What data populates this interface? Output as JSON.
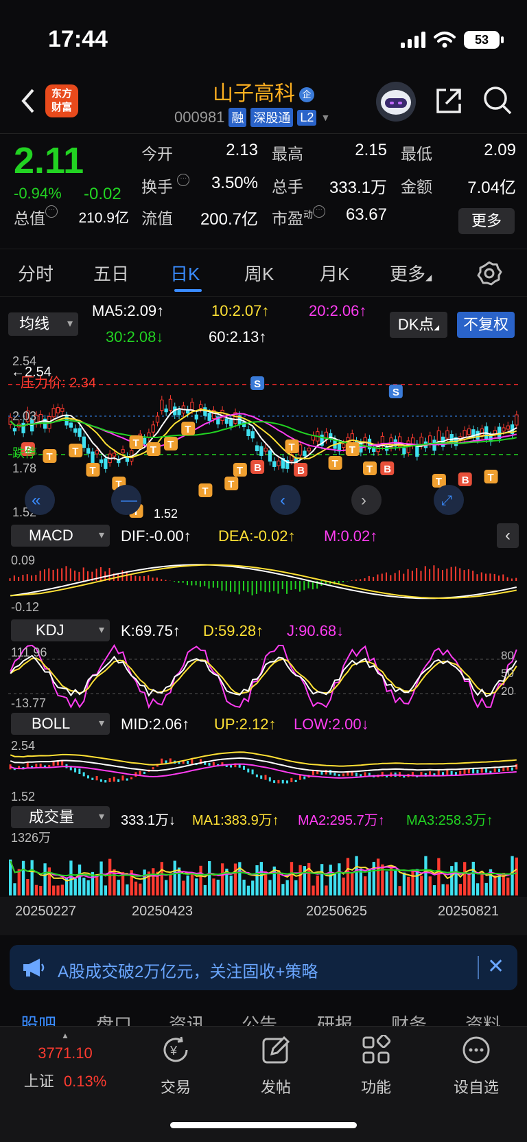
{
  "status_bar": {
    "time": "17:44",
    "battery": "53"
  },
  "header": {
    "brand_line1": "东方",
    "brand_line2": "财富",
    "stock_name": "山子高科",
    "qi_badge": "企",
    "stock_code": "000981",
    "tags": [
      "融",
      "深股通",
      "L2"
    ]
  },
  "quote": {
    "price": "2.11",
    "change_pct": "-0.94%",
    "change_abs": "-0.02",
    "open_label": "今开",
    "open": "2.13",
    "high_label": "最高",
    "high": "2.15",
    "low_label": "最低",
    "low": "2.09",
    "turnover_label": "换手",
    "turnover": "3.50%",
    "volume_label": "总手",
    "volume": "333.1万",
    "amount_label": "金额",
    "amount": "7.04亿",
    "mktcap_label": "总值",
    "mktcap": "210.9亿",
    "float_label": "流值",
    "float": "200.7亿",
    "pe_label": "市盈",
    "pe_sup": "动",
    "pe": "63.67",
    "more_label": "更多"
  },
  "tabs": [
    "分时",
    "五日",
    "日K",
    "周K",
    "月K",
    "更多"
  ],
  "active_tab": "日K",
  "ma_bar": {
    "dropdown": "均线",
    "ma5": "MA5:2.09↑",
    "ma10": "10:2.07↑",
    "ma20": "20:2.06↑",
    "ma30": "30:2.08↓",
    "ma60": "60:2.13↑",
    "dk_label": "DK点",
    "fq_label": "不复权"
  },
  "kline": {
    "y_top": "2.54",
    "y_mid1": "2.03",
    "y_mid2": "1.78",
    "y_bottom": "1.52",
    "high_marker": "←2.54",
    "low_marker": "1.52",
    "pressure_label": "压力价: 2.34",
    "support_label": "跌停"
  },
  "macd": {
    "dropdown": "MACD",
    "dif": "DIF:-0.00↑",
    "dea": "DEA:-0.02↑",
    "m": "M:0.02↑",
    "y_top": "0.09",
    "y_bottom": "-0.12"
  },
  "kdj": {
    "dropdown": "KDJ",
    "k": "K:69.75↑",
    "d": "D:59.28↑",
    "j": "J:90.68↓",
    "y_top": "111.96",
    "y_bottom": "-13.77",
    "r80": "80",
    "r50": "50",
    "r20": "20"
  },
  "boll": {
    "dropdown": "BOLL",
    "mid": "MID:2.06↑",
    "up": "UP:2.12↑",
    "low": "LOW:2.00↓",
    "y_top": "2.54",
    "y_bottom": "1.52"
  },
  "volume": {
    "dropdown": "成交量",
    "vol": "333.1万↓",
    "ma1": "MA1:383.9万↑",
    "ma2": "MA2:295.7万↑",
    "ma3": "MA3:258.3万↑",
    "y_top": "1326万"
  },
  "dates": [
    "20250227",
    "20250423",
    "20250625",
    "20250821"
  ],
  "banner": {
    "text": "A股成交破2万亿元，关注固收+策略"
  },
  "sub_tabs": [
    "股吧",
    "盘口",
    "资讯",
    "公告",
    "研报",
    "财务",
    "资料"
  ],
  "bottom_nav": {
    "index_value": "3771.10",
    "index_name": "上证",
    "index_change": "0.13%",
    "items": [
      "交易",
      "发帖",
      "功能",
      "设自选"
    ]
  },
  "colors": {
    "up": "#ff3b30",
    "down": "#22d322",
    "accent": "#3a8cff",
    "brand": "#e84a1c",
    "stock_name": "#ffb020"
  }
}
